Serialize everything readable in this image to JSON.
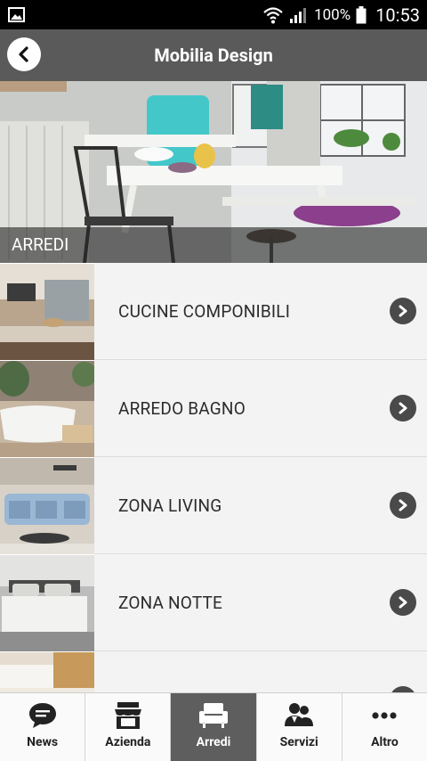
{
  "status_bar": {
    "battery": "100%",
    "time": "10:53"
  },
  "app_bar": {
    "title": "Mobilia Design",
    "back_icon": "chevron-left-icon"
  },
  "hero": {
    "label": "ARREDI"
  },
  "list": {
    "items": [
      {
        "label": "CUCINE COMPONIBILI"
      },
      {
        "label": "ARREDO BAGNO"
      },
      {
        "label": "ZONA LIVING"
      },
      {
        "label": "ZONA NOTTE"
      },
      {
        "label": ""
      }
    ]
  },
  "bottom_nav": {
    "tabs": [
      {
        "label": "News",
        "icon": "chat-bubble-icon",
        "active": false
      },
      {
        "label": "Azienda",
        "icon": "storefront-icon",
        "active": false
      },
      {
        "label": "Arredi",
        "icon": "armchair-icon",
        "active": true
      },
      {
        "label": "Servizi",
        "icon": "people-icon",
        "active": false
      },
      {
        "label": "Altro",
        "icon": "more-dots-icon",
        "active": false
      }
    ]
  }
}
